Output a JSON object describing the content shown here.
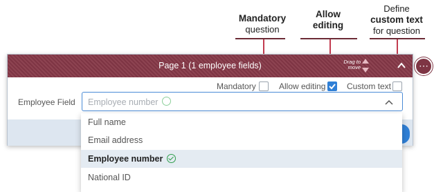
{
  "callouts": {
    "mandatory": {
      "bold": "Mandatory",
      "rest": "question"
    },
    "allow_editing": {
      "bold": "Allow",
      "bold2": "editing"
    },
    "custom_text": {
      "top": "Define",
      "bold": "custom text",
      "rest": "for question"
    }
  },
  "header": {
    "title": "Page 1 (1 employee fields)",
    "drag_line1": "Drag to",
    "drag_line2": "move",
    "more_glyph": "⋯"
  },
  "options": {
    "mandatory_label": "Mandatory",
    "mandatory_checked": false,
    "allow_editing_label": "Allow editing",
    "allow_editing_checked": true,
    "custom_text_label": "Custom text",
    "custom_text_checked": false
  },
  "field": {
    "label": "Employee Field",
    "value": "Employee number"
  },
  "dropdown": {
    "items": [
      {
        "label": "Full name",
        "selected": false
      },
      {
        "label": "Email address",
        "selected": false
      },
      {
        "label": "Employee number",
        "selected": true
      },
      {
        "label": "National ID",
        "selected": false
      }
    ]
  },
  "colors": {
    "header": "#7e3544",
    "accent": "#2f7fd6",
    "check_green": "#2e9e4b"
  }
}
